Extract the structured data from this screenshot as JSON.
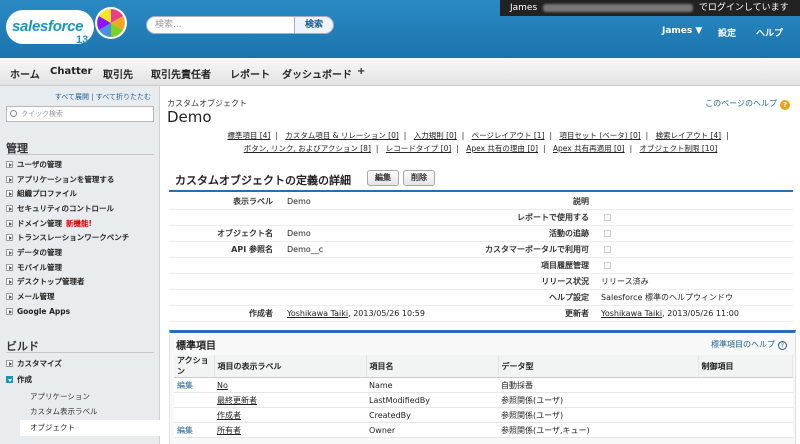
{
  "header": {
    "brand": "salesforce",
    "version": "13",
    "search_placeholder": "検索...",
    "search_button": "検索",
    "login_prefix": "James",
    "login_suffix": "でログインしています",
    "user_name": "James ▼",
    "setup": "設定",
    "help": "ヘルプ"
  },
  "tabs": [
    "ホーム",
    "Chatter",
    "取引先",
    "取引先責任者",
    "レポート",
    "ダッシュボード",
    "+"
  ],
  "sidebar": {
    "expand_all": "すべて展開",
    "collapse_all": "すべて折りたたむ",
    "quick_find_placeholder": "クイック検索",
    "admin_heading": "管理",
    "admin_items": [
      "ユーザの管理",
      "アプリケーションを管理する",
      "組織プロファイル",
      "セキュリティのコントロール",
      "ドメイン管理",
      "トランスレーションワークベンチ",
      "データの管理",
      "モバイル管理",
      "デスクトップ管理者",
      "メール管理",
      "Google Apps"
    ],
    "new_badge": "新機能!",
    "build_heading": "ビルド",
    "build_items": [
      "カスタマイズ",
      "作成"
    ],
    "create_sub": [
      "アプリケーション",
      "カスタム表示ラベル",
      "オブジェクト"
    ]
  },
  "page": {
    "object_type": "カスタムオブジェクト",
    "object_name": "Demo",
    "help_link": "このページのヘルプ",
    "links_row1": [
      "標準項目 [4]",
      "カスタム項目 & リレーション [0]",
      "入力規則 [0]",
      "ページレイアウト [1]",
      "項目セット (ベータ) [0]",
      "検索レイアウト [4]"
    ],
    "links_row2": [
      "ボタン, リンク, およびアクション [8]",
      "レコードタイプ [0]",
      "Apex 共有の理由 [0]",
      "Apex 共有再適用 [0]",
      "オブジェクト制限 [10]"
    ]
  },
  "detail": {
    "title": "カスタムオブジェクトの定義の詳細",
    "edit_button": "編集",
    "delete_button": "削除",
    "left": {
      "label_label": "表示ラベル",
      "label_value": "Demo",
      "objname_label": "オブジェクト名",
      "objname_value": "Demo",
      "api_label": "API 参照名",
      "api_value": "Demo__c",
      "created_label": "作成者",
      "created_user": "Yoshikawa Taiki",
      "created_date": ", 2013/05/26 10:59"
    },
    "right": {
      "desc_label": "説明",
      "reports_label": "レポートで使用する",
      "activity_label": "活動の追跡",
      "portal_label": "カスタマーポータルで利用可",
      "history_label": "項目履歴管理",
      "release_label": "リリース状況",
      "release_value": "リリース済み",
      "helpset_label": "ヘルプ設定",
      "helpset_value": "Salesforce 標準のヘルプウィンドウ",
      "modified_label": "更新者",
      "modified_user": "Yoshikawa Taiki",
      "modified_date": ", 2013/05/26 11:00"
    }
  },
  "standard_fields": {
    "title": "標準項目",
    "help": "標準項目のヘルプ",
    "columns": [
      "アクション",
      "項目の表示ラベル",
      "項目名",
      "データ型",
      "制御項目"
    ],
    "rows": [
      {
        "action": "編集",
        "label": "No",
        "name": "Name",
        "type": "自動採番"
      },
      {
        "action": "",
        "label": "最終更新者",
        "name": "LastModifiedBy",
        "type": "参照関係(ユーザ)"
      },
      {
        "action": "",
        "label": "作成者",
        "name": "CreatedBy",
        "type": "参照関係(ユーザ)"
      },
      {
        "action": "編集",
        "label": "所有者",
        "name": "Owner",
        "type": "参照関係(ユーザ,キュー)"
      }
    ]
  },
  "colors": {
    "header_blue": "#1c74ad",
    "link_blue": "#1c5f94",
    "accent_blue": "#236fbd",
    "sidebar_bg": "#e8ecef"
  }
}
